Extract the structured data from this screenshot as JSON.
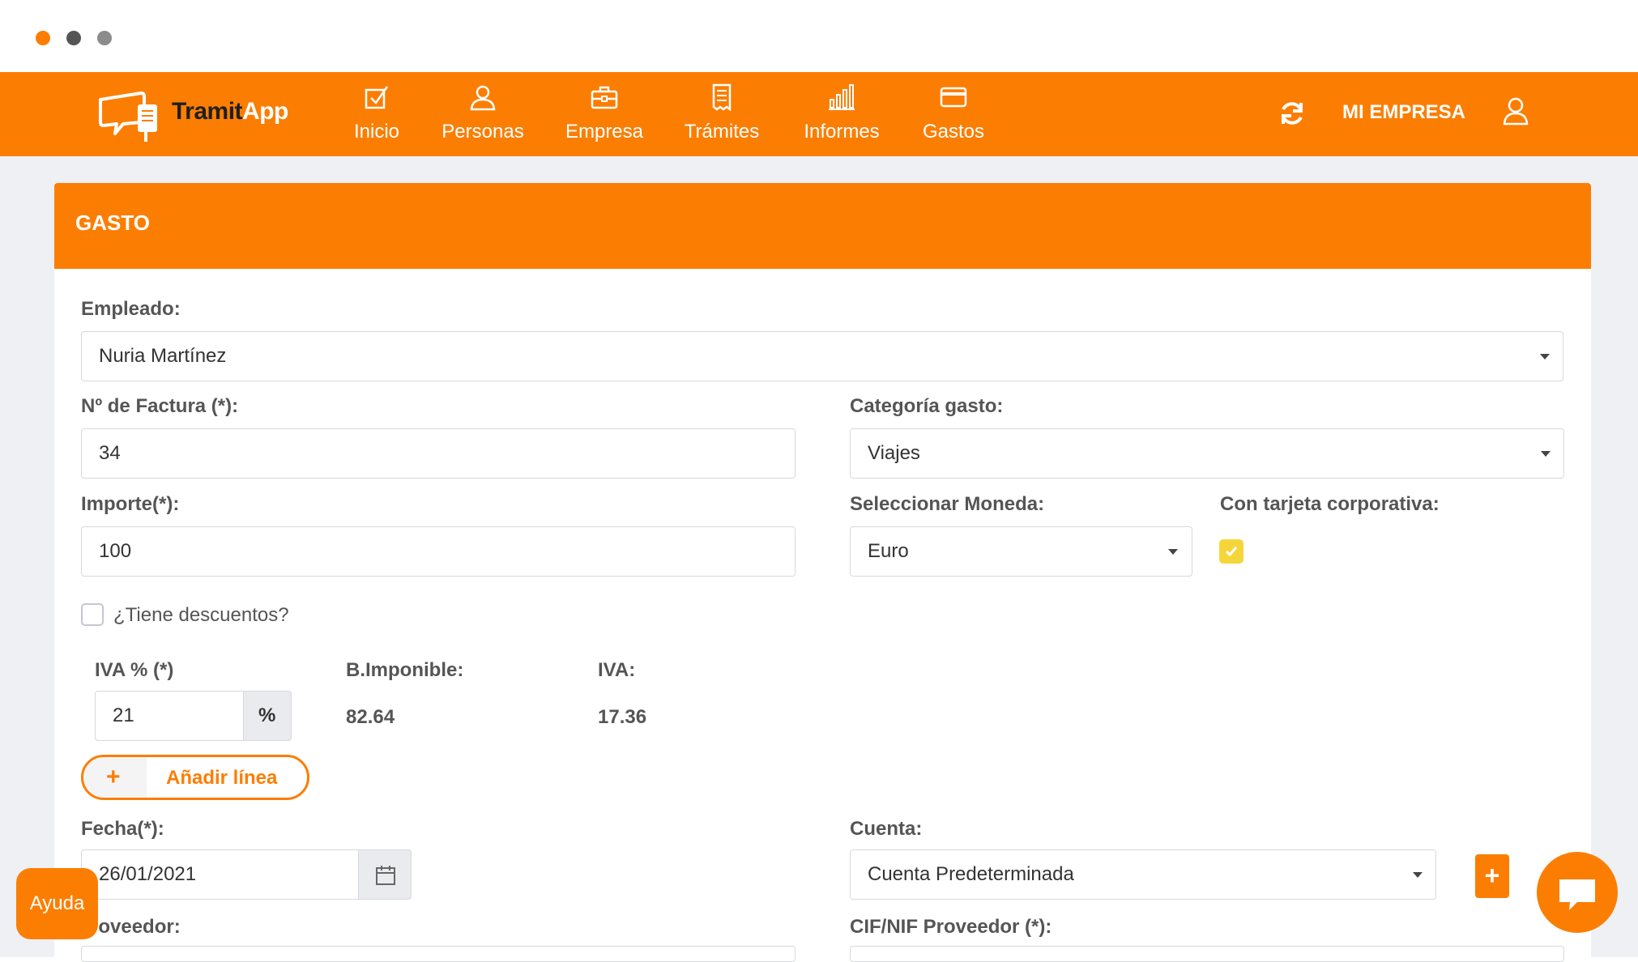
{
  "colors": {
    "accent": "#fb7e03",
    "window_dots": [
      "#fb7e03",
      "#555555",
      "#8c8c8c"
    ]
  },
  "app": {
    "logo_part1": "Tramit",
    "logo_part2": "App"
  },
  "nav": {
    "items": [
      {
        "label": "Inicio",
        "icon": "checkbox-icon"
      },
      {
        "label": "Personas",
        "icon": "person-icon"
      },
      {
        "label": "Empresa",
        "icon": "briefcase-icon"
      },
      {
        "label": "Trámites",
        "icon": "document-icon"
      },
      {
        "label": "Informes",
        "icon": "bar-chart-icon"
      },
      {
        "label": "Gastos",
        "icon": "credit-card-icon"
      }
    ],
    "company": "MI EMPRESA",
    "refresh_icon": "refresh-icon",
    "user_icon": "user-icon"
  },
  "card": {
    "title": "GASTO"
  },
  "form": {
    "empleado": {
      "label": "Empleado:",
      "value": "Nuria Martínez"
    },
    "factura": {
      "label": "Nº de Factura (*):",
      "value": "34"
    },
    "categoria": {
      "label": "Categoría gasto:",
      "value": "Viajes"
    },
    "importe": {
      "label": "Importe(*):",
      "value": "100"
    },
    "moneda": {
      "label": "Seleccionar Moneda:",
      "value": "Euro"
    },
    "tarjeta": {
      "label": "Con tarjeta corporativa:",
      "checked": true
    },
    "descuentos": {
      "label": "¿Tiene descuentos?",
      "checked": false
    },
    "iva_pct": {
      "label": "IVA % (*)",
      "value": "21",
      "addon": "%"
    },
    "base_imponible": {
      "label": "B.Imponible:",
      "value": "82.64"
    },
    "iva": {
      "label": "IVA:",
      "value": "17.36"
    },
    "add_line": {
      "plus": "+",
      "label": "Añadir línea"
    },
    "fecha": {
      "label": "Fecha(*):",
      "value": "26/01/2021"
    },
    "cuenta": {
      "label": "Cuenta:",
      "value": "Cuenta Predeterminada",
      "add": "+"
    },
    "proveedor": {
      "label": "roveedor:"
    },
    "cif": {
      "label": "CIF/NIF Proveedor (*):"
    }
  },
  "help": {
    "label": "Ayuda"
  }
}
